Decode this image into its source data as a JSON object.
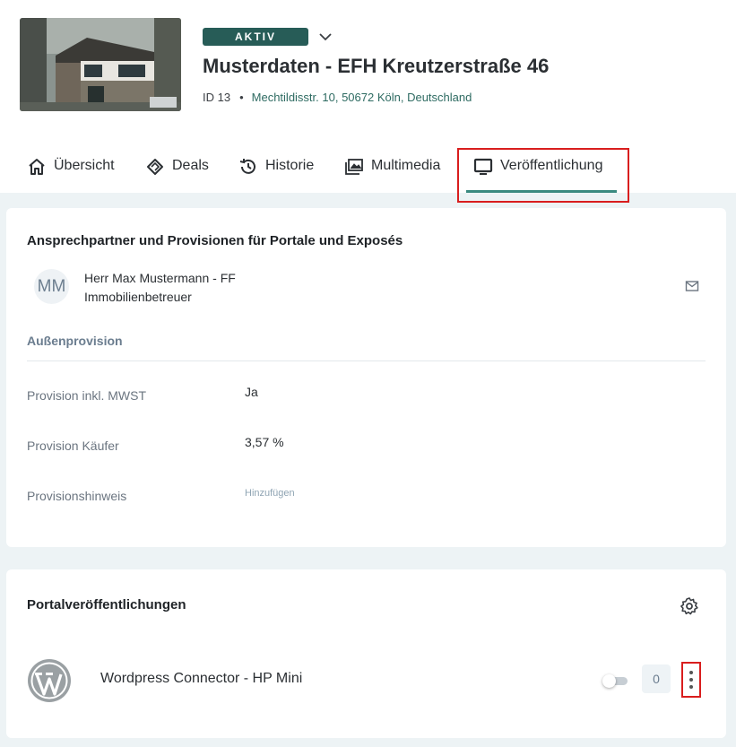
{
  "property": {
    "status": "AKTIV",
    "title": "Musterdaten - EFH Kreutzerstraße 46",
    "id_label": "ID 13",
    "separator": "•",
    "address": "Mechtildisstr. 10, 50672 Köln, Deutschland"
  },
  "tabs": [
    {
      "label": "Übersicht",
      "icon": "home-icon"
    },
    {
      "label": "Deals",
      "icon": "handshake-icon"
    },
    {
      "label": "Historie",
      "icon": "history-icon"
    },
    {
      "label": "Multimedia",
      "icon": "images-icon"
    },
    {
      "label": "Veröffentlichung",
      "icon": "monitor-icon",
      "active": true
    }
  ],
  "contact_card": {
    "title": "Ansprechpartner und Provisionen für Portale und Exposés",
    "avatar_initials": "MM",
    "contact_name": "Herr Max Mustermann - FF",
    "contact_role": "Immobilienbetreuer",
    "section_label": "Außenprovision",
    "rows": [
      {
        "label": "Provision inkl. MWST",
        "value": "Ja"
      },
      {
        "label": "Provision Käufer",
        "value": "3,57 %"
      },
      {
        "label": "Provisionshinweis",
        "value": "Hinzufügen"
      }
    ]
  },
  "portals_card": {
    "title": "Portalveröffentlichungen",
    "items": [
      {
        "name": "Wordpress Connector - HP Mini",
        "count": "0",
        "enabled": false,
        "icon": "wordpress-icon"
      }
    ]
  },
  "colors": {
    "status_bg": "#275c57",
    "accent": "#3a8a80",
    "highlight": "#d91e1e",
    "link": "#2e6b62"
  }
}
